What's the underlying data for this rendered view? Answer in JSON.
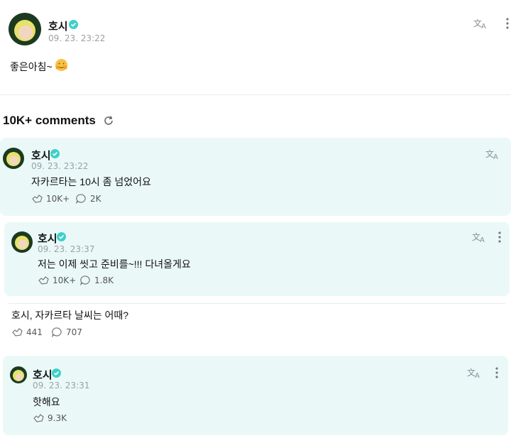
{
  "post": {
    "author": "호시",
    "time": "09. 23. 23:22",
    "text": "좋은아침~"
  },
  "comments_header": {
    "label": "10K+ comments"
  },
  "comments": [
    {
      "author": "호시",
      "time": "09. 23. 23:22",
      "text": "자카르타는 10시 좀 넘었어요",
      "likes": "10K+",
      "replies": "2K"
    },
    {
      "author": "호시",
      "time": "09. 23. 23:37",
      "text": "저는 이제 씻고 준비를~!!! 다녀올게요",
      "likes": "10K+",
      "replies": "1.8K"
    },
    {
      "author": "",
      "time": "",
      "text": "호시, 자카르타 날씨는 어때?",
      "likes": "441",
      "replies": "707"
    },
    {
      "author": "호시",
      "time": "09. 23. 23:31",
      "text": "핫해요",
      "likes": "9.3K",
      "replies": ""
    }
  ],
  "colors": {
    "highlight_bg": "#eaf9f8",
    "verified": "#3fd0c9",
    "muted_text": "#9aa0a6"
  },
  "icons": {
    "verified": "verified-badge-icon",
    "translate": "translate-icon",
    "more": "more-vertical-icon",
    "refresh": "refresh-icon",
    "like": "like-icon",
    "reply": "reply-icon",
    "emoji": "hug-emoji-icon"
  }
}
